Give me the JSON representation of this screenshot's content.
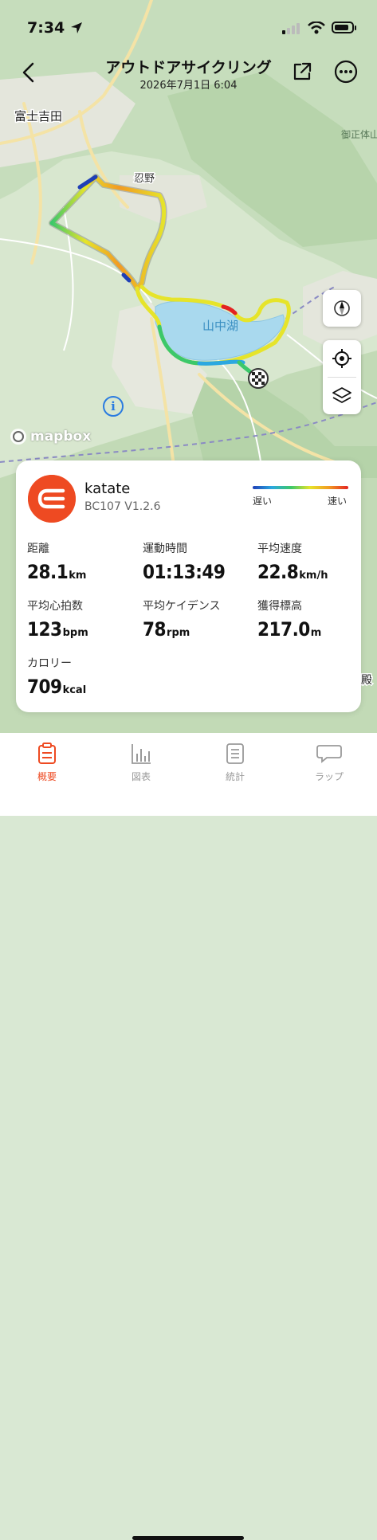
{
  "status_bar": {
    "time": "7:34"
  },
  "header": {
    "title": "アウトドアサイクリング",
    "datetime": "2026年7月1日 6:04"
  },
  "map": {
    "labels": {
      "fujiyoshida": "富士吉田",
      "oshino": "忍野",
      "lake": "山中湖",
      "gotemba_edge": "殿",
      "mishoutai_edge": "御正体山"
    },
    "attribution": "mapbox",
    "track_colors": [
      "#1f3fb6",
      "#2ba8e0",
      "#3cc86a",
      "#e6e42a",
      "#f29a22",
      "#e32222"
    ]
  },
  "device": {
    "name": "katate",
    "model": "BC107  V1.2.6",
    "brand_color": "#ee4a22"
  },
  "legend": {
    "slow": "遅い",
    "fast": "速い"
  },
  "stats": {
    "distance": {
      "label": "距離",
      "value": "28.1",
      "unit": "km"
    },
    "duration": {
      "label": "運動時間",
      "value": "01:13:49",
      "unit": ""
    },
    "avg_speed": {
      "label": "平均速度",
      "value": "22.8",
      "unit": "km/h"
    },
    "avg_hr": {
      "label": "平均心拍数",
      "value": "123",
      "unit": "bpm"
    },
    "avg_cadence": {
      "label": "平均ケイデンス",
      "value": "78",
      "unit": "rpm"
    },
    "elevation_gain": {
      "label": "獲得標高",
      "value": "217.0",
      "unit": "m"
    },
    "calories": {
      "label": "カロリー",
      "value": "709",
      "unit": "kcal"
    }
  },
  "tabs": [
    {
      "label": "概要",
      "icon": "summary-icon",
      "active": true
    },
    {
      "label": "図表",
      "icon": "chart-icon",
      "active": false
    },
    {
      "label": "統計",
      "icon": "stats-list-icon",
      "active": false
    },
    {
      "label": "ラップ",
      "icon": "lap-bubble-icon",
      "active": false
    }
  ],
  "colors": {
    "accent": "#ee4a22",
    "tab_inactive": "#999999"
  }
}
